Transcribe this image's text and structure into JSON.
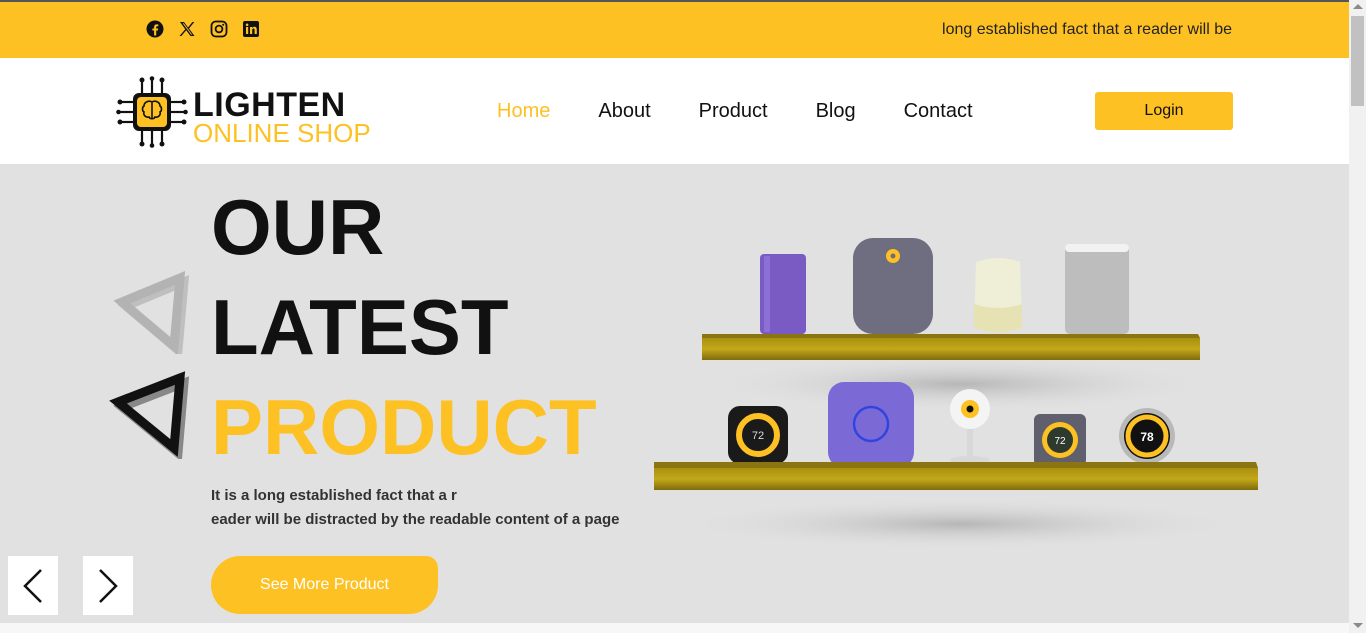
{
  "topbar": {
    "socials": [
      "facebook-icon",
      "x-icon",
      "instagram-icon",
      "linkedin-icon"
    ],
    "marquee_text": "long established fact that a reader will be"
  },
  "logo": {
    "line1": "LIGHTEN",
    "line2": "ONLINE SHOP"
  },
  "nav": {
    "items": [
      {
        "label": "Home",
        "active": true
      },
      {
        "label": "About",
        "active": false
      },
      {
        "label": "Product",
        "active": false
      },
      {
        "label": "Blog",
        "active": false
      },
      {
        "label": "Contact",
        "active": false
      }
    ],
    "login_label": "Login"
  },
  "hero": {
    "line1": "OUR",
    "line2": "LATEST",
    "line3": "PRODUCT",
    "desc_line1": "It is a long established fact that a r",
    "desc_line2": "eader will be distracted by the readable content of a page",
    "cta_label": "See More Product",
    "thermostat_readings": [
      "72",
      "72",
      "78"
    ]
  },
  "colors": {
    "accent": "#fec123",
    "hero_bg": "#e2e1e2",
    "text_dark": "#111111"
  }
}
